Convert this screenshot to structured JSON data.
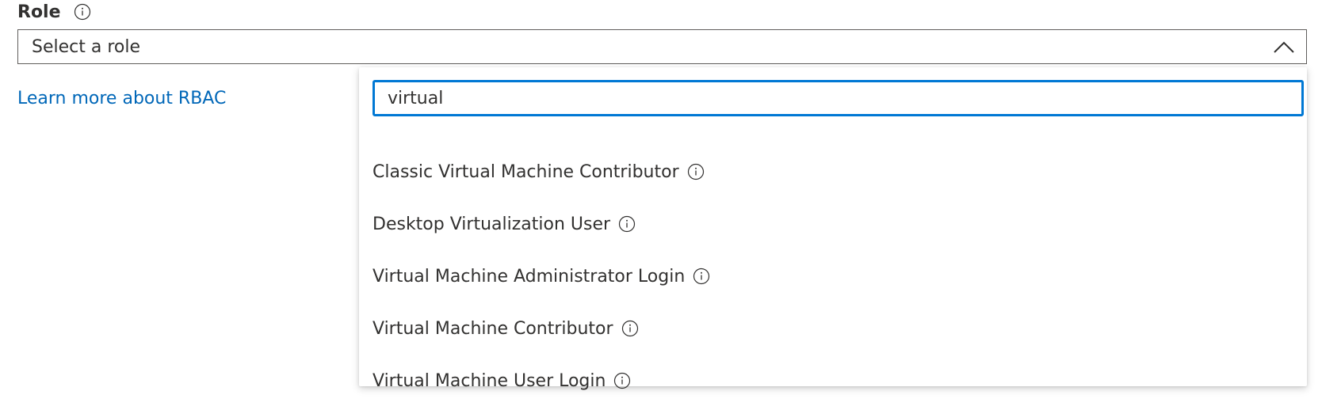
{
  "field": {
    "label": "Role",
    "label_icon": "info-icon",
    "select": {
      "selected_text": "Select a role",
      "state": "expanded",
      "toggle_icon": "chevron-up-icon"
    }
  },
  "learn_more_link": "Learn more about RBAC",
  "dropdown": {
    "search": {
      "value": "virtual",
      "placeholder": ""
    },
    "options": [
      {
        "label": "Classic Virtual Machine Contributor",
        "icon": "info-icon"
      },
      {
        "label": "Desktop Virtualization User",
        "icon": "info-icon"
      },
      {
        "label": "Virtual Machine Administrator Login",
        "icon": "info-icon"
      },
      {
        "label": "Virtual Machine Contributor",
        "icon": "info-icon"
      },
      {
        "label": "Virtual Machine User Login",
        "icon": "info-icon"
      }
    ]
  },
  "colors": {
    "accent": "#0078d4",
    "link": "#0067b8",
    "text": "#323130",
    "border": "#605e5c"
  }
}
